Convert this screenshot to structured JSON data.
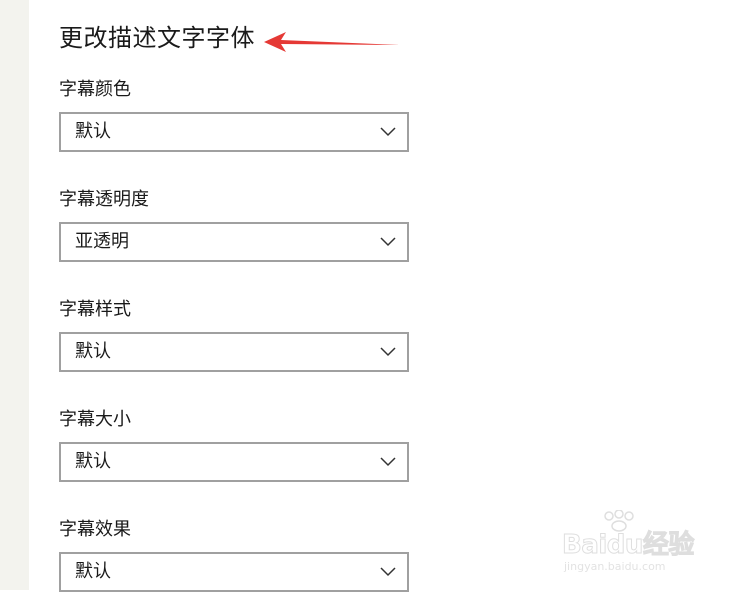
{
  "page": {
    "title": "更改描述文字字体"
  },
  "settings": [
    {
      "label": "字幕颜色",
      "value": "默认"
    },
    {
      "label": "字幕透明度",
      "value": "亚透明"
    },
    {
      "label": "字幕样式",
      "value": "默认"
    },
    {
      "label": "字幕大小",
      "value": "默认"
    },
    {
      "label": "字幕效果",
      "value": "默认"
    }
  ],
  "watermark": {
    "brand": "Baidu经验",
    "url": "jingyan.baidu.com"
  },
  "colors": {
    "annotation_arrow": "#e53935",
    "dropdown_border": "#a0a0a0",
    "left_strip": "#f3f3ee"
  },
  "icons": {
    "dropdown": "chevron-down-icon",
    "annotation": "arrow-left-icon"
  }
}
